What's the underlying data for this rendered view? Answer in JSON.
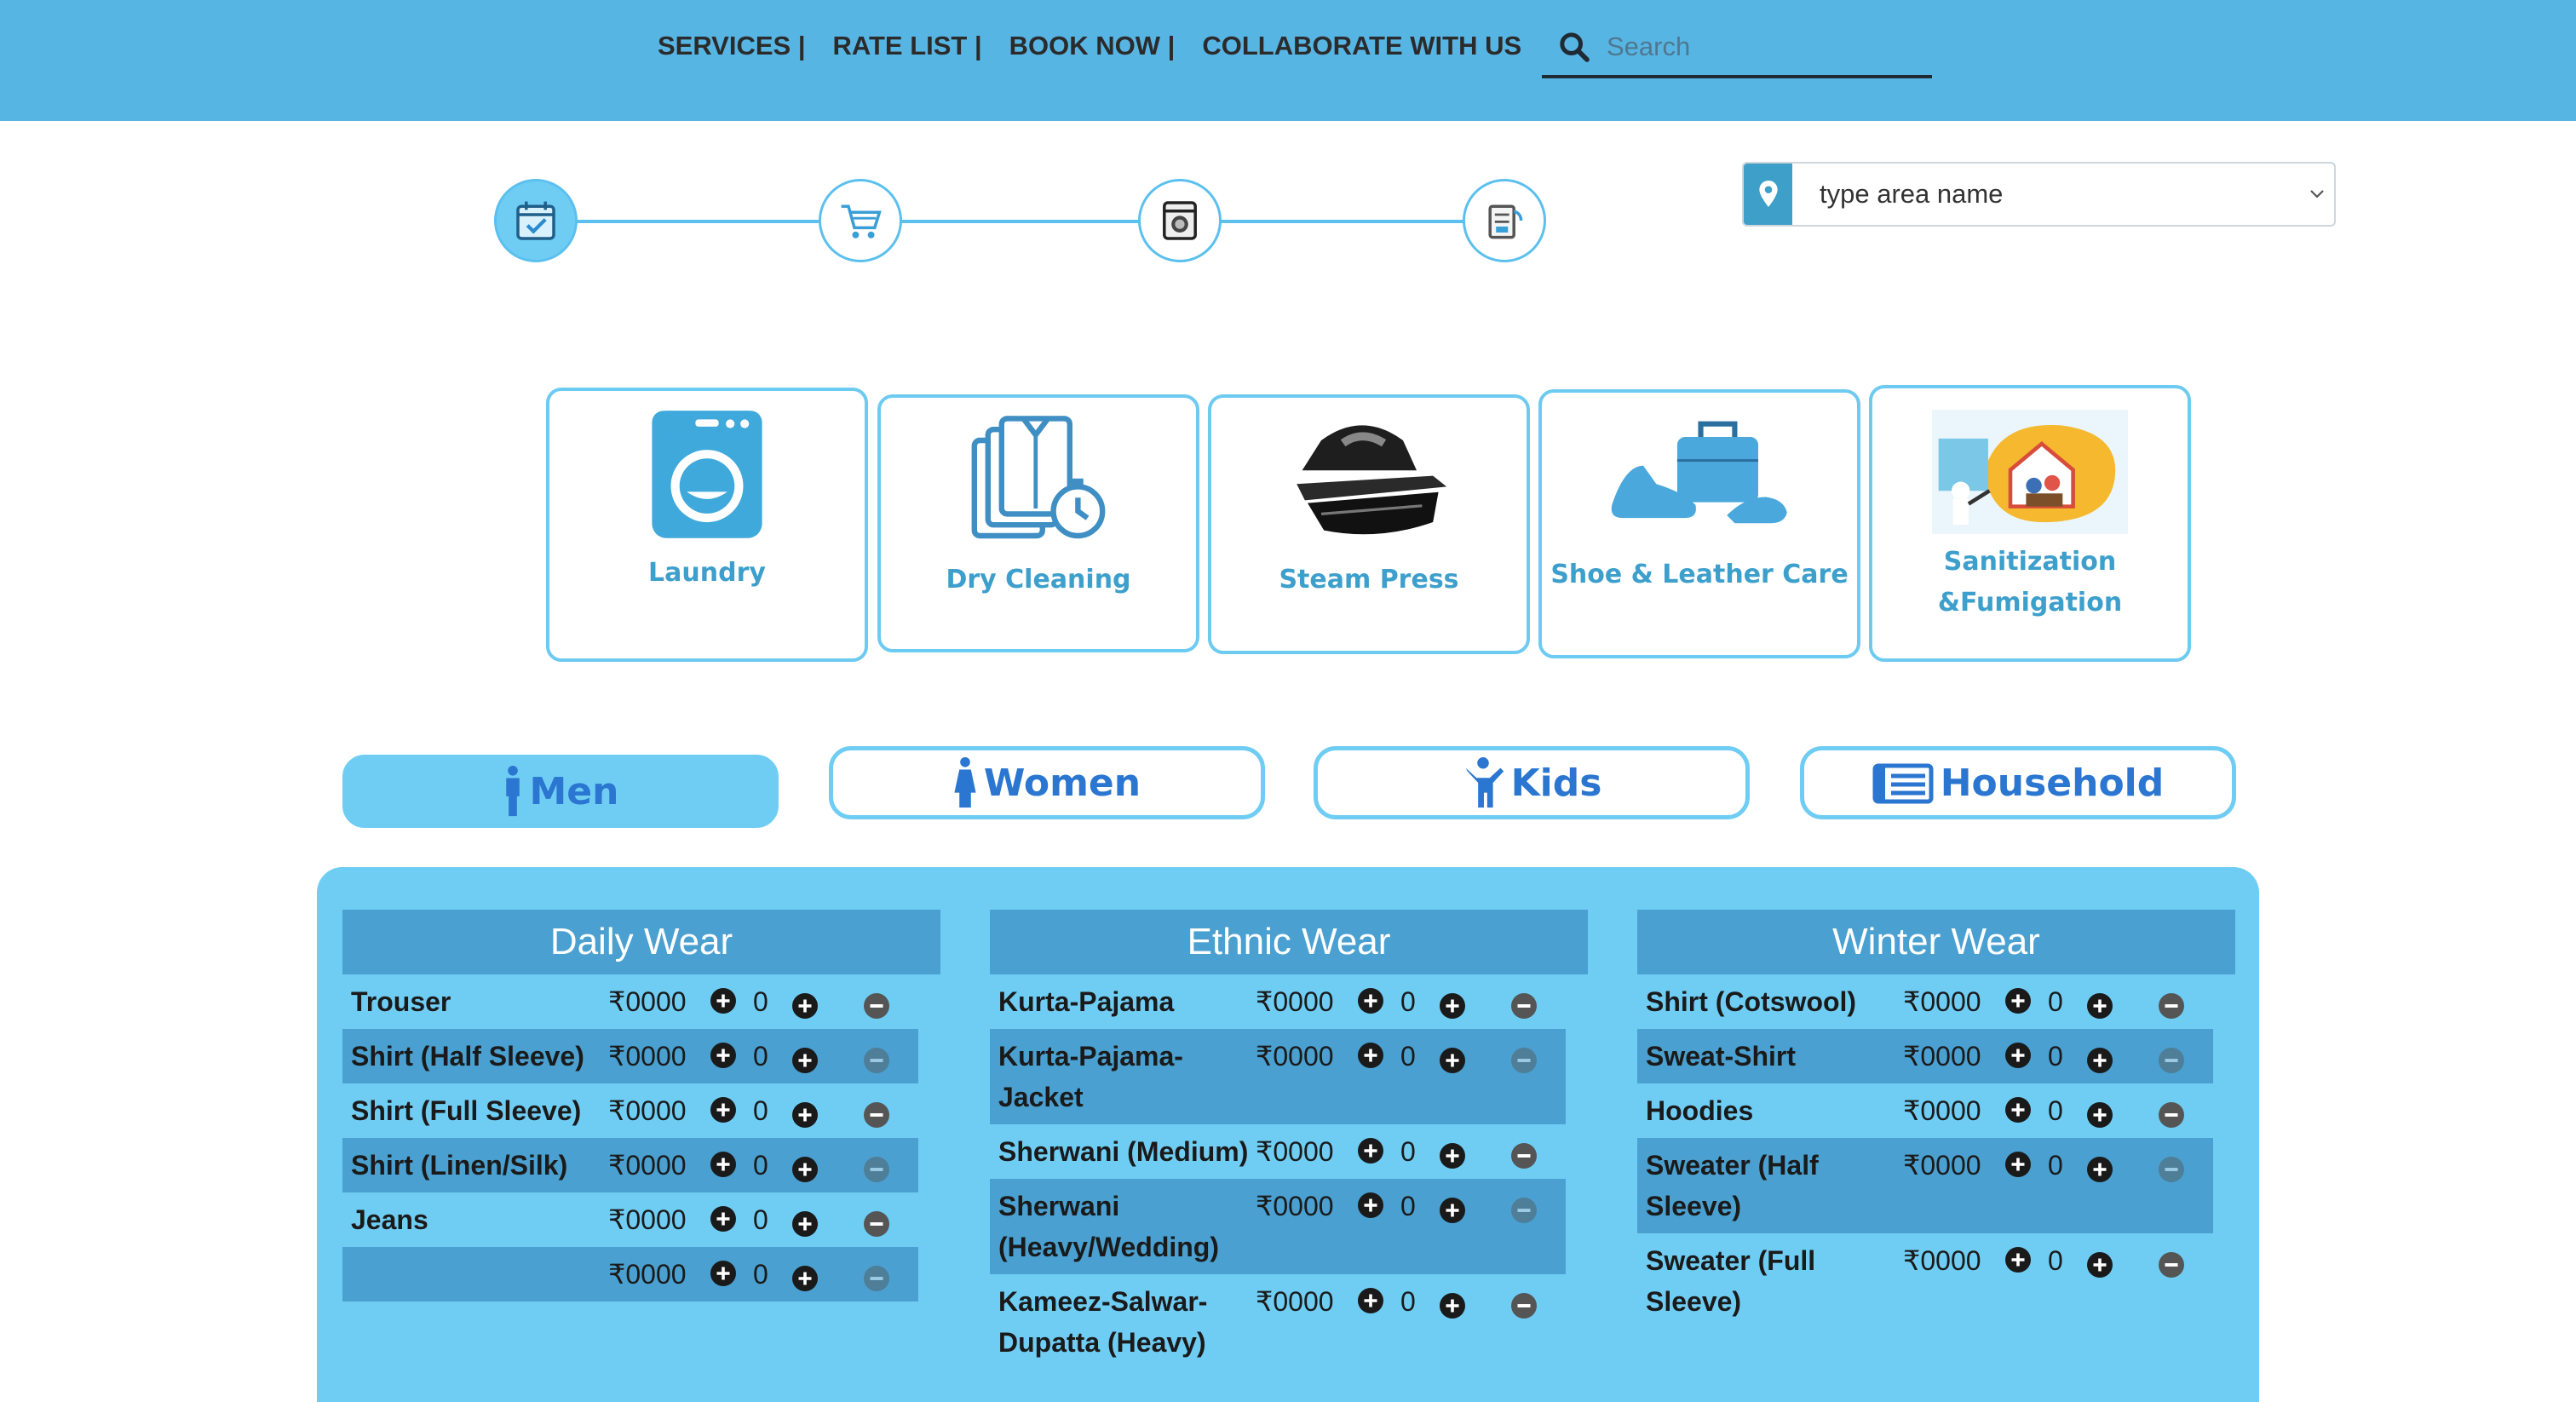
{
  "nav": {
    "items": [
      "SERVICES |",
      "RATE LIST |",
      "BOOK NOW |",
      "COLLABORATE WITH US"
    ],
    "search_placeholder": "Search"
  },
  "steps": {
    "icons": [
      "calendar-icon",
      "cart-icon",
      "washing-machine-icon",
      "delivery-icon"
    ],
    "active_step": 1
  },
  "area_select": {
    "value": "type area name"
  },
  "services": [
    {
      "label": "Laundry",
      "icon": "washing-machine-icon"
    },
    {
      "label": "Dry Cleaning",
      "icon": "shirt-timer-icon"
    },
    {
      "label": "Steam Press",
      "icon": "steam-iron-icon"
    },
    {
      "label": "Shoe & Leather Care",
      "icon": "shoe-bag-icon"
    },
    {
      "label": "Sanitization &Fumigation",
      "icon": "sanitization-icon"
    }
  ],
  "categories": [
    {
      "label": "Men",
      "icon": "man-icon",
      "active": true
    },
    {
      "label": "Women",
      "icon": "woman-icon",
      "active": false
    },
    {
      "label": "Kids",
      "icon": "child-icon",
      "active": false
    },
    {
      "label": "Household",
      "icon": "household-icon",
      "active": false
    }
  ],
  "columns": [
    {
      "title": "Daily Wear",
      "rows": [
        {
          "name": "Trouser",
          "price": "₹0000",
          "qty": "0"
        },
        {
          "name": "Shirt (Half Sleeve)",
          "price": "₹0000",
          "qty": "0"
        },
        {
          "name": "Shirt (Full Sleeve)",
          "price": "₹0000",
          "qty": "0"
        },
        {
          "name": "Shirt (Linen/Silk)",
          "price": "₹0000",
          "qty": "0"
        },
        {
          "name": "Jeans",
          "price": "₹0000",
          "qty": "0"
        },
        {
          "name": "",
          "price": "₹0000",
          "qty": "0"
        }
      ]
    },
    {
      "title": "Ethnic Wear",
      "rows": [
        {
          "name": "Kurta-Pajama",
          "price": "₹0000",
          "qty": "0"
        },
        {
          "name": "Kurta-Pajama-Jacket",
          "price": "₹0000",
          "qty": "0"
        },
        {
          "name": "Sherwani (Medium)",
          "price": "₹0000",
          "qty": "0"
        },
        {
          "name": "Sherwani (Heavy/Wedding)",
          "price": "₹0000",
          "qty": "0"
        },
        {
          "name": "Kameez-Salwar-Dupatta (Heavy)",
          "price": "₹0000",
          "qty": "0"
        }
      ]
    },
    {
      "title": "Winter Wear",
      "rows": [
        {
          "name": "Shirt (Cotswool)",
          "price": "₹0000",
          "qty": "0"
        },
        {
          "name": "Sweat-Shirt",
          "price": "₹0000",
          "qty": "0"
        },
        {
          "name": "Hoodies",
          "price": "₹0000",
          "qty": "0"
        },
        {
          "name": "Sweater (Half Sleeve)",
          "price": "₹0000",
          "qty": "0"
        },
        {
          "name": "Sweater (Full Sleeve)",
          "price": "₹0000",
          "qty": "0"
        }
      ]
    }
  ],
  "colors": {
    "header_bg": "#57b5e4",
    "accent": "#6fcdf4",
    "column_head": "#4aa0d0",
    "service_label": "#3d9fcb",
    "tab_label": "#2a76d0"
  }
}
